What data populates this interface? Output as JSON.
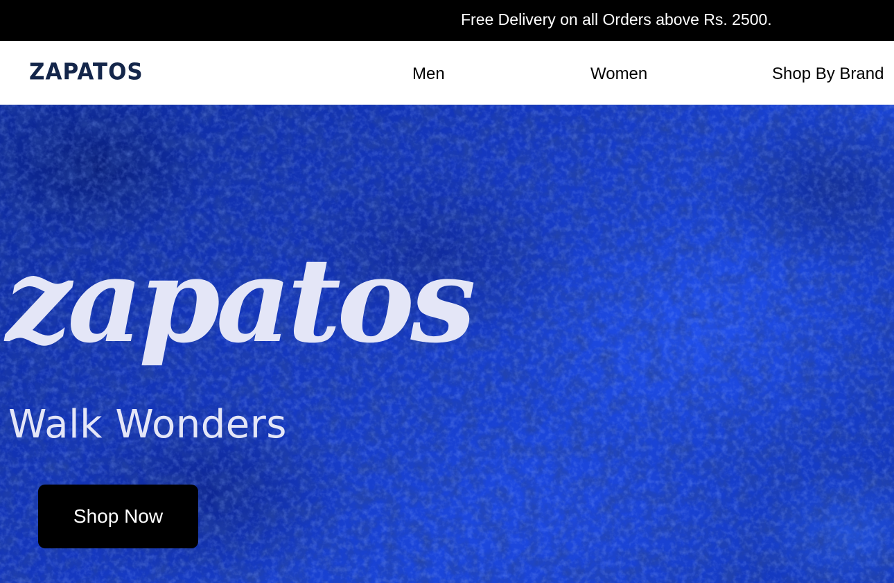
{
  "announcement": {
    "text": "Free Delivery on all Orders above Rs. 2500."
  },
  "header": {
    "logo": "ZAPATOS",
    "nav": {
      "men": "Men",
      "women": "Women",
      "shop_by_brand": "Shop By Brand"
    }
  },
  "hero": {
    "wordmark": "zapatos",
    "tagline": "Walk Wonders",
    "cta_label": "Shop Now"
  },
  "colors": {
    "announcement_bg": "#000000",
    "logo": "#14264a",
    "hero_blue": "#1538c0",
    "hero_text": "#e4e6f7",
    "cta_bg": "#000000"
  }
}
